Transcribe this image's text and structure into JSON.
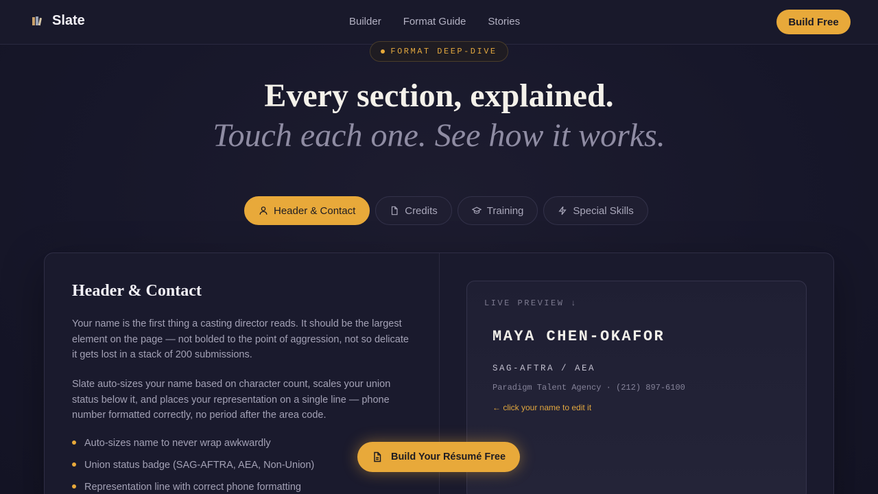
{
  "nav": {
    "brand": "Slate",
    "brand_icon": "books-icon",
    "links": [
      "Builder",
      "Format Guide",
      "Stories"
    ],
    "cta": "Build Free"
  },
  "hero": {
    "badge": "FORMAT DEEP-DIVE",
    "title": "Every section, explained.",
    "subtitle": "Touch each one. See how it works."
  },
  "tabs": [
    {
      "label": "Header & Contact",
      "icon": "user-icon",
      "active": true
    },
    {
      "label": "Credits",
      "icon": "file-icon",
      "active": false
    },
    {
      "label": "Training",
      "icon": "graduation-cap-icon",
      "active": false
    },
    {
      "label": "Special Skills",
      "icon": "lightning-icon",
      "active": false
    }
  ],
  "section": {
    "title": "Header & Contact",
    "paragraphs": [
      "Your name is the first thing a casting director reads. It should be the largest element on the page — not bolded to the point of aggression, not so delicate it gets lost in a stack of 200 submissions.",
      "Slate auto-sizes your name based on character count, scales your union status below it, and places your representation on a single line — phone number formatted correctly, no period after the area code."
    ],
    "bullets": [
      "Auto-sizes name to never wrap awkwardly",
      "Union status badge (SAG-AFTRA, AEA, Non-Union)",
      "Representation line with correct phone formatting"
    ]
  },
  "preview": {
    "label": "LIVE PREVIEW ↓",
    "name": "MAYA CHEN-OKAFOR",
    "union": "SAG-AFTRA / AEA",
    "rep": "Paradigm Talent Agency · (212) 897-6100",
    "hint": "← click your name to edit it"
  },
  "float_cta": "Build Your Résumé Free",
  "colors": {
    "accent": "#e8a93a",
    "background": "#17172a"
  }
}
